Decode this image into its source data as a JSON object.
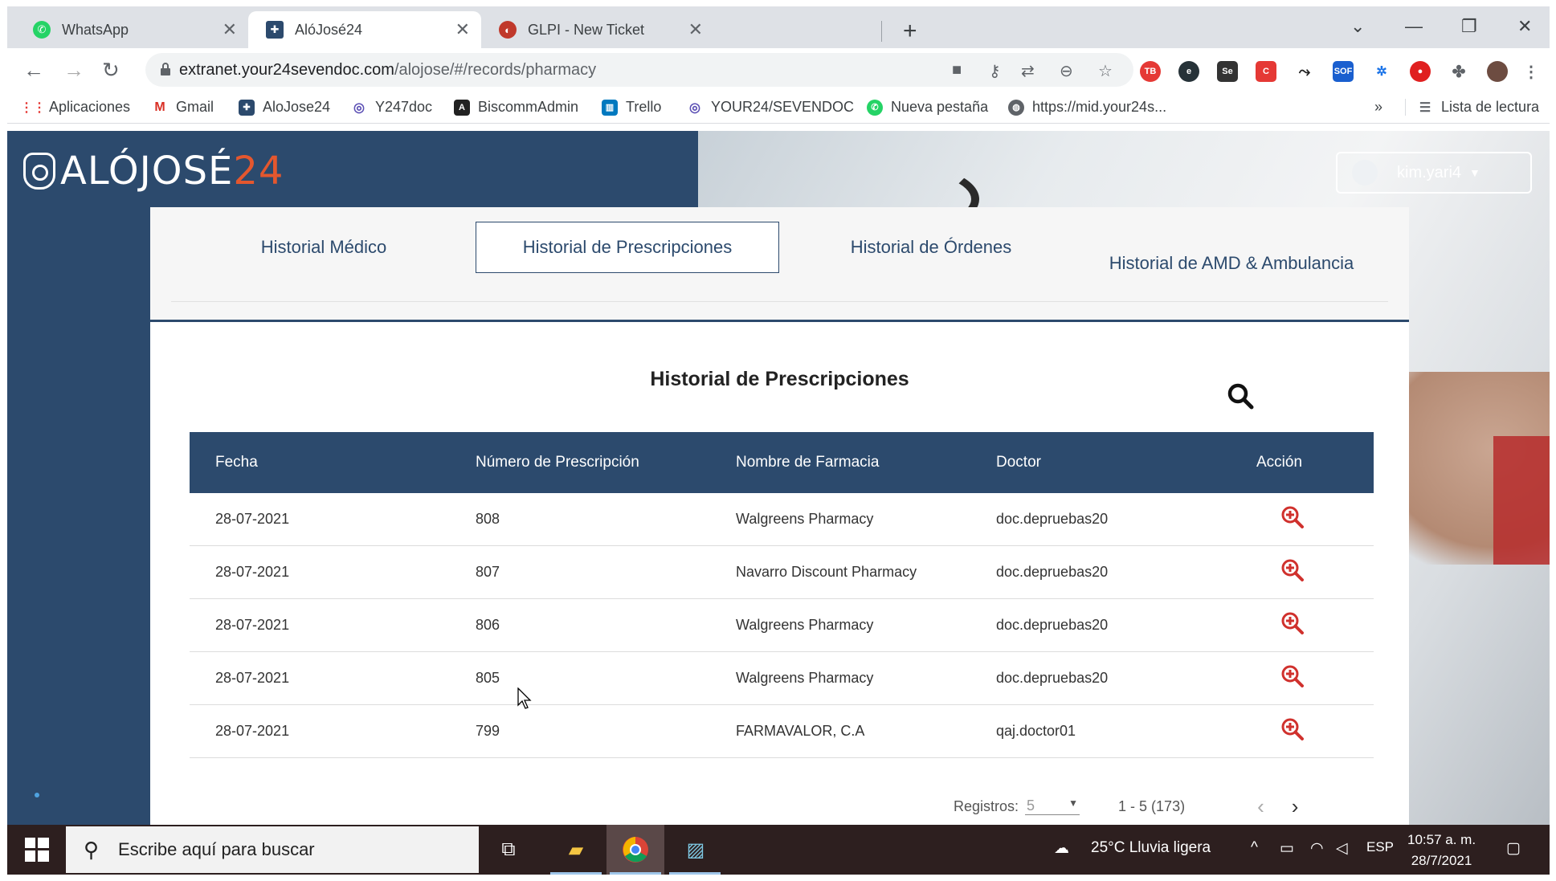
{
  "browser": {
    "tabs": [
      {
        "title": "WhatsApp",
        "icon": "whatsapp-icon",
        "color": "#25d366"
      },
      {
        "title": "AlóJosé24",
        "icon": "alojose-icon",
        "color": "#2c4a6d"
      },
      {
        "title": "GLPI - New Ticket",
        "icon": "glpi-icon",
        "color": "#c0392b"
      }
    ],
    "url_host": "extranet.your24sevendoc.com",
    "url_path": "/alojose/#/records/pharmacy",
    "bookmarks": [
      {
        "label": "Aplicaciones",
        "icon": "apps-grid-icon"
      },
      {
        "label": "Gmail",
        "icon": "gmail-icon"
      },
      {
        "label": "AloJose24",
        "icon": "alojose-icon"
      },
      {
        "label": "Y247doc",
        "icon": "y247doc-icon"
      },
      {
        "label": "BiscommAdmin",
        "icon": "angular-icon"
      },
      {
        "label": "Trello",
        "icon": "trello-icon"
      },
      {
        "label": "YOUR24/SEVENDOC",
        "icon": "your24-icon"
      },
      {
        "label": "Nueva pestaña",
        "icon": "whatsapp-icon"
      },
      {
        "label": "https://mid.your24s...",
        "icon": "globe-icon"
      }
    ],
    "reading_list": "Lista de lectura",
    "overflow": "»"
  },
  "app": {
    "logo_text": "ALÓJOSÉ",
    "logo_num": "24",
    "username": "kim.yari4",
    "nav_tabs": [
      {
        "label": "Historial Médico",
        "active": false
      },
      {
        "label": "Historial de Prescripciones",
        "active": true
      },
      {
        "label": "Historial de Órdenes",
        "active": false
      },
      {
        "label": "Historial de AMD & Ambulancia",
        "active": false
      }
    ],
    "section_title": "Historial de Prescripciones",
    "table": {
      "headers": [
        "Fecha",
        "Número de Prescripción",
        "Nombre de Farmacia",
        "Doctor",
        "Acción"
      ],
      "rows": [
        [
          "28-07-2021",
          "808",
          "Walgreens Pharmacy",
          "doc.depruebas20"
        ],
        [
          "28-07-2021",
          "807",
          "Navarro Discount Pharmacy",
          "doc.depruebas20"
        ],
        [
          "28-07-2021",
          "806",
          "Walgreens Pharmacy",
          "doc.depruebas20"
        ],
        [
          "28-07-2021",
          "805",
          "Walgreens Pharmacy",
          "doc.depruebas20"
        ],
        [
          "28-07-2021",
          "799",
          "FARMAVALOR, C.A",
          "qaj.doctor01"
        ]
      ]
    },
    "pager": {
      "label": "Registros:",
      "per_page": "5",
      "range": "1 - 5 (173)"
    },
    "accent_color": "#2c4a6d",
    "action_color": "#d0312d"
  },
  "taskbar": {
    "search_placeholder": "Escribe aquí para buscar",
    "weather": "25°C  Lluvia ligera",
    "language": "ESP",
    "time": "10:57 a. m.",
    "date": "28/7/2021"
  }
}
